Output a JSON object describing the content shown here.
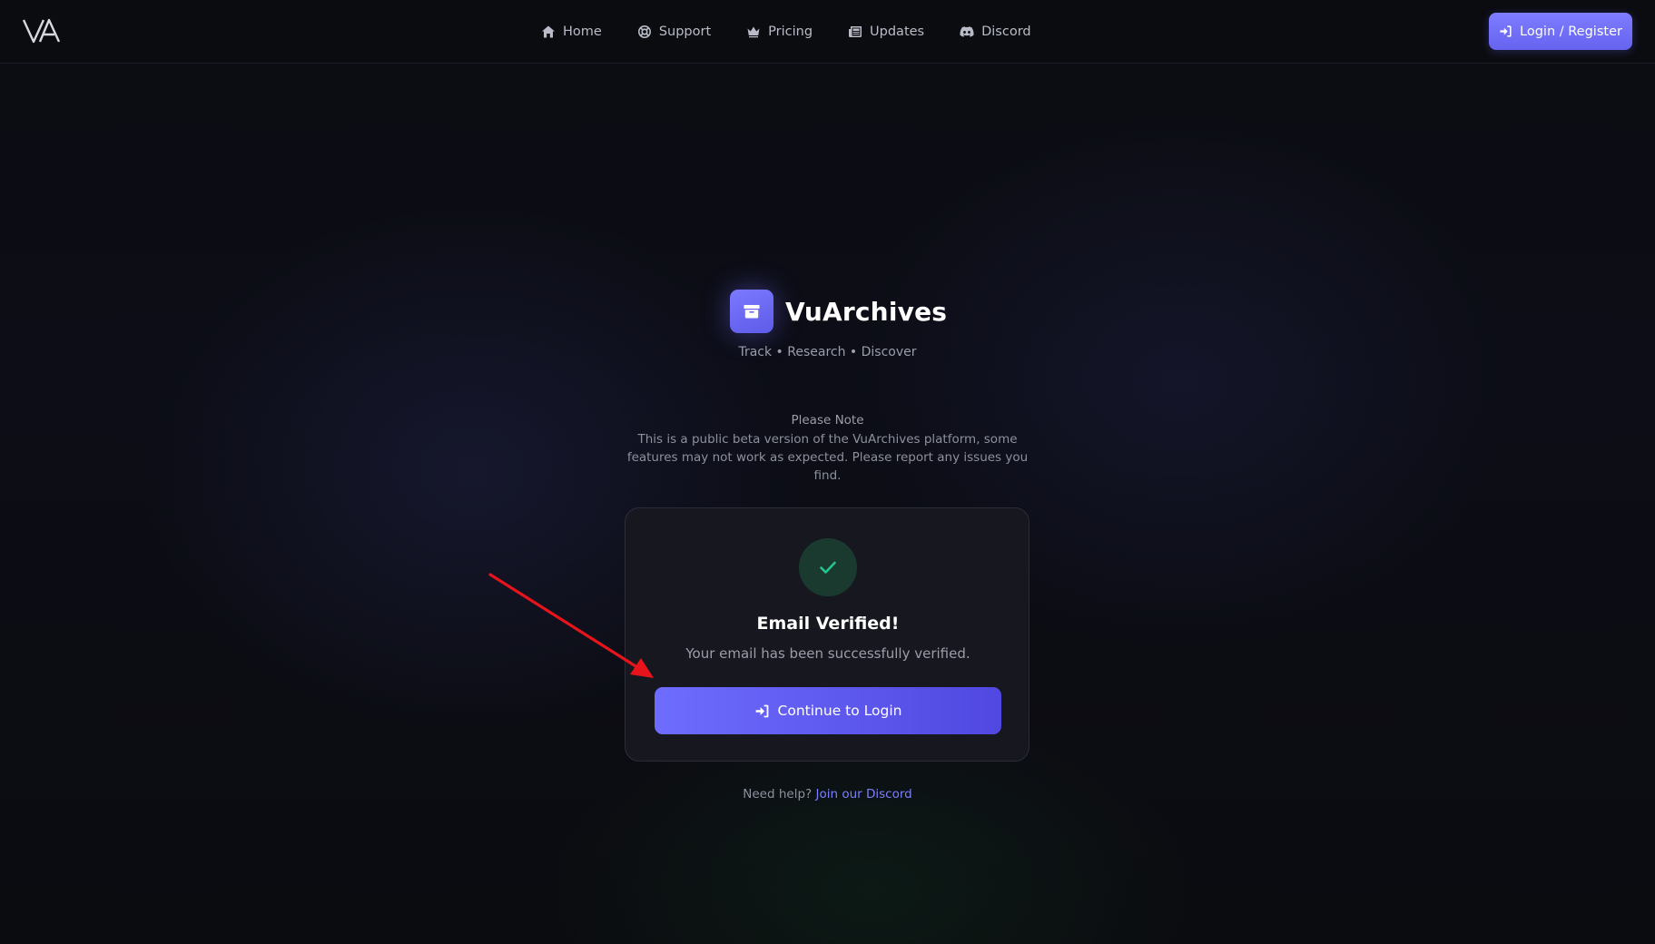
{
  "navbar": {
    "logo_text": "VA",
    "links": [
      {
        "label": "Home",
        "icon": "home-icon"
      },
      {
        "label": "Support",
        "icon": "lifebuoy-icon"
      },
      {
        "label": "Pricing",
        "icon": "crown-icon"
      },
      {
        "label": "Updates",
        "icon": "newspaper-icon"
      },
      {
        "label": "Discord",
        "icon": "discord-icon"
      }
    ],
    "login_label": "Login / Register"
  },
  "brand": {
    "name": "VuArchives",
    "icon": "archive-box-icon",
    "tagline": "Track • Research • Discover"
  },
  "note": {
    "title": "Please Note",
    "text": "This is a public beta version of the VuArchives platform, some features may not work as expected. Please report any issues you find."
  },
  "card": {
    "icon": "checkmark-icon",
    "title": "Email Verified!",
    "subtitle": "Your email has been successfully verified.",
    "button_label": "Continue to Login"
  },
  "help": {
    "prefix": "Need help?",
    "link_label": "Join our Discord"
  },
  "colors": {
    "accent": "#6e6cff",
    "success": "#22c58b",
    "background": "#0b0c10",
    "annotation_arrow": "#e8141c"
  }
}
